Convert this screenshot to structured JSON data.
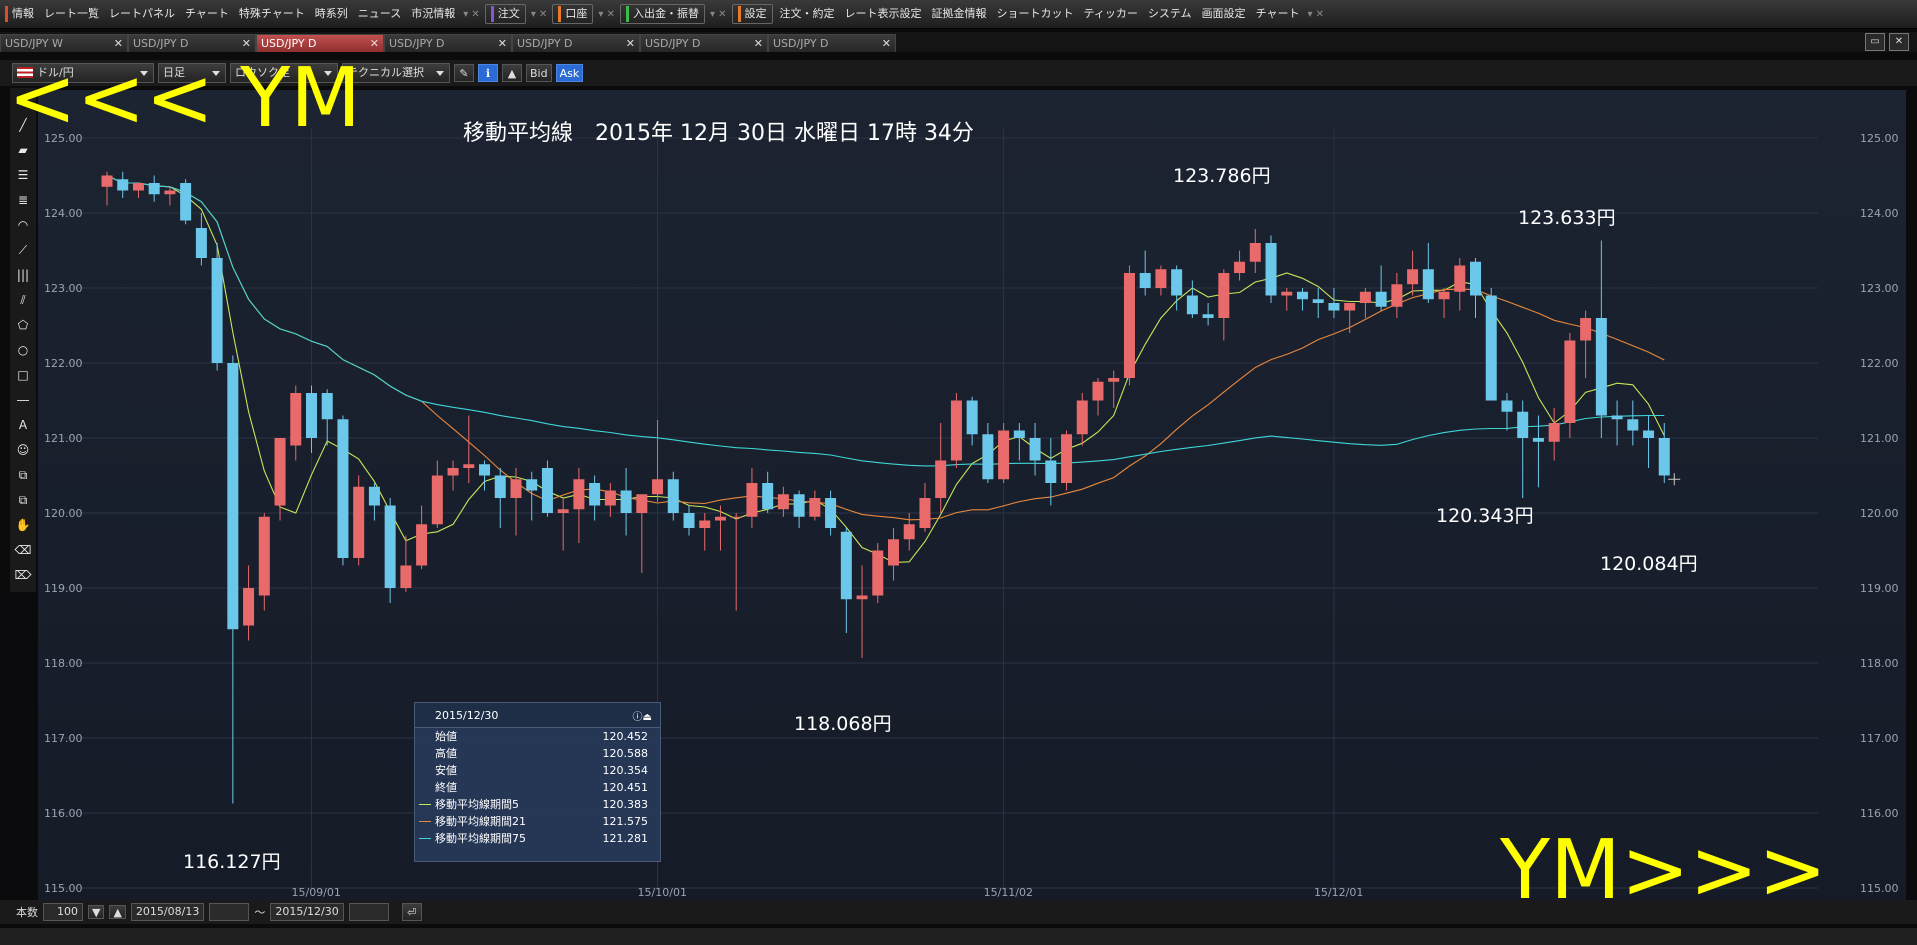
{
  "menubar": {
    "items": [
      "情報",
      "レート一覧",
      "レートパネル",
      "チャート",
      "特殊チャート",
      "時系列",
      "ニュース",
      "市況情報",
      "注文",
      "口座",
      "入出金・振替",
      "設定",
      "注文・約定",
      "レート表示設定",
      "証拠金情報",
      "ショートカット",
      "ティッカー",
      "システム",
      "画面設定",
      "チャート"
    ]
  },
  "tabs": [
    {
      "label": "USD/JPY W",
      "active": false
    },
    {
      "label": "USD/JPY D",
      "active": false
    },
    {
      "label": "USD/JPY D",
      "active": true
    },
    {
      "label": "USD/JPY D",
      "active": false
    },
    {
      "label": "USD/JPY D",
      "active": false
    },
    {
      "label": "USD/JPY D",
      "active": false
    },
    {
      "label": "USD/JPY D",
      "active": false
    }
  ],
  "toolbar": {
    "pair": "ドル/円",
    "timeframe": "日足",
    "chart_type": "ロウソク足",
    "technical": "テクニカル選択",
    "bid": "Bid",
    "ask": "Ask"
  },
  "bottombar": {
    "count_label": "本数",
    "count_value": "100",
    "from": "2015/08/13",
    "tilde": "〜",
    "to": "2015/12/30"
  },
  "overlay": {
    "top_left": "<<< YM",
    "bottom_right": "YM>>>"
  },
  "chart_title": "移動平均線　2015年 12月 30日 水曜日 17時 34分",
  "callouts": {
    "high_nov": "123.786円",
    "high_dec": "123.633円",
    "low_aug": "116.127円",
    "low_oct": "118.068円",
    "dec_mid": "120.343円",
    "dec_end": "120.084円"
  },
  "info_panel": {
    "date": "2015/12/30",
    "rows": [
      {
        "label": "始値",
        "value": "120.452",
        "color": ""
      },
      {
        "label": "高値",
        "value": "120.588",
        "color": ""
      },
      {
        "label": "安値",
        "value": "120.354",
        "color": ""
      },
      {
        "label": "終値",
        "value": "120.451",
        "color": ""
      },
      {
        "label": "移動平均線期間5",
        "value": "120.383",
        "color": "#c8e65a"
      },
      {
        "label": "移動平均線期間21",
        "value": "121.575",
        "color": "#e8883c"
      },
      {
        "label": "移動平均線期間75",
        "value": "121.281",
        "color": "#3ed6d6"
      }
    ]
  },
  "chart_data": {
    "type": "candlestick",
    "ylim": [
      115.0,
      125.0
    ],
    "y_ticks": [
      "125.00",
      "124.00",
      "123.00",
      "122.00",
      "121.00",
      "120.00",
      "119.00",
      "118.00",
      "117.00",
      "116.00",
      "115.00"
    ],
    "x_ticks": [
      {
        "label": "15/09/01",
        "index": 13
      },
      {
        "label": "15/10/01",
        "index": 35
      },
      {
        "label": "15/11/02",
        "index": 57
      },
      {
        "label": "15/12/01",
        "index": 78
      }
    ],
    "candles": [
      [
        124.35,
        124.55,
        124.1,
        124.5
      ],
      [
        124.45,
        124.55,
        124.2,
        124.3
      ],
      [
        124.3,
        124.4,
        124.2,
        124.4
      ],
      [
        124.4,
        124.5,
        124.15,
        124.25
      ],
      [
        124.25,
        124.35,
        124.1,
        124.3
      ],
      [
        124.4,
        124.45,
        123.85,
        123.9
      ],
      [
        123.8,
        124.0,
        123.3,
        123.4
      ],
      [
        123.4,
        123.6,
        121.9,
        122.0
      ],
      [
        122.0,
        122.1,
        116.127,
        118.45
      ],
      [
        118.5,
        119.3,
        118.3,
        119.0
      ],
      [
        118.9,
        120.0,
        118.7,
        119.95
      ],
      [
        120.1,
        121.0,
        119.9,
        121.0
      ],
      [
        120.9,
        121.7,
        120.7,
        121.6
      ],
      [
        121.6,
        121.7,
        120.8,
        121.0
      ],
      [
        121.6,
        121.65,
        120.9,
        121.25
      ],
      [
        121.25,
        121.3,
        119.3,
        119.4
      ],
      [
        119.4,
        120.5,
        119.3,
        120.35
      ],
      [
        120.35,
        120.4,
        119.9,
        120.1
      ],
      [
        120.1,
        120.2,
        118.8,
        119.0
      ],
      [
        119.0,
        119.7,
        118.95,
        119.3
      ],
      [
        119.3,
        120.1,
        119.25,
        119.85
      ],
      [
        119.85,
        120.7,
        119.8,
        120.5
      ],
      [
        120.5,
        120.7,
        120.3,
        120.6
      ],
      [
        120.6,
        121.3,
        120.4,
        120.65
      ],
      [
        120.65,
        120.7,
        120.3,
        120.5
      ],
      [
        120.5,
        120.6,
        119.8,
        120.2
      ],
      [
        120.2,
        120.6,
        119.7,
        120.45
      ],
      [
        120.45,
        120.55,
        119.9,
        120.3
      ],
      [
        120.6,
        120.7,
        119.95,
        120.0
      ],
      [
        120.0,
        120.2,
        119.5,
        120.05
      ],
      [
        120.05,
        120.6,
        119.6,
        120.45
      ],
      [
        120.4,
        120.5,
        119.9,
        120.1
      ],
      [
        120.1,
        120.4,
        119.95,
        120.3
      ],
      [
        120.3,
        120.6,
        119.7,
        120.0
      ],
      [
        120.0,
        120.2,
        119.2,
        120.25
      ],
      [
        120.25,
        121.24,
        120.15,
        120.45
      ],
      [
        120.45,
        120.55,
        119.9,
        120.0
      ],
      [
        120.0,
        120.1,
        119.7,
        119.8
      ],
      [
        119.8,
        120.0,
        119.5,
        119.9
      ],
      [
        119.9,
        120.1,
        119.5,
        119.95
      ],
      [
        119.95,
        120.0,
        118.7,
        119.95
      ],
      [
        119.95,
        120.6,
        119.8,
        120.4
      ],
      [
        120.4,
        120.55,
        120.0,
        120.05
      ],
      [
        120.05,
        120.35,
        119.95,
        120.25
      ],
      [
        120.25,
        120.3,
        119.8,
        119.95
      ],
      [
        119.95,
        120.3,
        119.9,
        120.2
      ],
      [
        120.2,
        120.3,
        119.7,
        119.8
      ],
      [
        119.75,
        119.8,
        118.4,
        118.85
      ],
      [
        118.85,
        119.3,
        118.068,
        118.9
      ],
      [
        118.9,
        119.6,
        118.8,
        119.5
      ],
      [
        119.3,
        119.8,
        119.1,
        119.65
      ],
      [
        119.65,
        120.0,
        119.5,
        119.85
      ],
      [
        119.8,
        120.4,
        119.75,
        120.2
      ],
      [
        120.2,
        121.2,
        120.0,
        120.7
      ],
      [
        120.7,
        121.6,
        120.6,
        121.5
      ],
      [
        121.5,
        121.55,
        120.9,
        121.05
      ],
      [
        121.05,
        121.2,
        120.4,
        120.45
      ],
      [
        120.45,
        121.2,
        120.4,
        121.1
      ],
      [
        121.1,
        121.2,
        120.7,
        121.0
      ],
      [
        121.0,
        121.2,
        120.5,
        120.7
      ],
      [
        120.7,
        121.0,
        120.1,
        120.4
      ],
      [
        120.4,
        121.1,
        120.3,
        121.05
      ],
      [
        121.05,
        121.6,
        120.9,
        121.5
      ],
      [
        121.5,
        121.8,
        121.3,
        121.75
      ],
      [
        121.75,
        121.9,
        121.4,
        121.8
      ],
      [
        121.8,
        123.3,
        121.7,
        123.2
      ],
      [
        123.2,
        123.5,
        122.9,
        123.0
      ],
      [
        123.0,
        123.3,
        122.9,
        123.25
      ],
      [
        123.25,
        123.3,
        122.7,
        122.9
      ],
      [
        122.9,
        123.1,
        122.6,
        122.65
      ],
      [
        122.65,
        122.8,
        122.5,
        122.6
      ],
      [
        122.6,
        123.25,
        122.3,
        123.2
      ],
      [
        123.2,
        123.5,
        123.1,
        123.35
      ],
      [
        123.35,
        123.786,
        123.2,
        123.6
      ],
      [
        123.6,
        123.7,
        122.8,
        122.9
      ],
      [
        122.9,
        123.0,
        122.7,
        122.95
      ],
      [
        122.95,
        123.0,
        122.7,
        122.85
      ],
      [
        122.85,
        123.0,
        122.6,
        122.8
      ],
      [
        122.8,
        123.0,
        122.6,
        122.7
      ],
      [
        122.7,
        122.8,
        122.4,
        122.8
      ],
      [
        122.8,
        123.0,
        122.6,
        122.95
      ],
      [
        122.95,
        123.3,
        122.7,
        122.75
      ],
      [
        122.75,
        123.2,
        122.6,
        123.05
      ],
      [
        123.05,
        123.5,
        122.9,
        123.25
      ],
      [
        123.25,
        123.6,
        122.8,
        122.85
      ],
      [
        122.85,
        123.0,
        122.6,
        122.95
      ],
      [
        122.95,
        123.4,
        122.7,
        123.3
      ],
      [
        123.35,
        123.4,
        122.6,
        122.9
      ],
      [
        122.9,
        123.0,
        121.8,
        121.5
      ],
      [
        121.5,
        121.6,
        121.1,
        121.35
      ],
      [
        121.35,
        121.5,
        120.2,
        121.0
      ],
      [
        121.0,
        121.3,
        120.343,
        120.95
      ],
      [
        120.95,
        121.4,
        120.7,
        121.2
      ],
      [
        121.2,
        122.4,
        121.0,
        122.3
      ],
      [
        122.3,
        122.7,
        121.8,
        122.6
      ],
      [
        122.6,
        123.633,
        121.0,
        121.3
      ],
      [
        121.3,
        121.5,
        120.9,
        121.25
      ],
      [
        121.25,
        121.5,
        120.9,
        121.1
      ],
      [
        121.1,
        121.3,
        120.6,
        121.0
      ],
      [
        121.0,
        121.2,
        120.4,
        120.5
      ]
    ],
    "ma_periods": [
      5,
      21,
      75
    ],
    "ma_colors": [
      "#c8e65a",
      "#e8883c",
      "#3ed6d6"
    ]
  }
}
